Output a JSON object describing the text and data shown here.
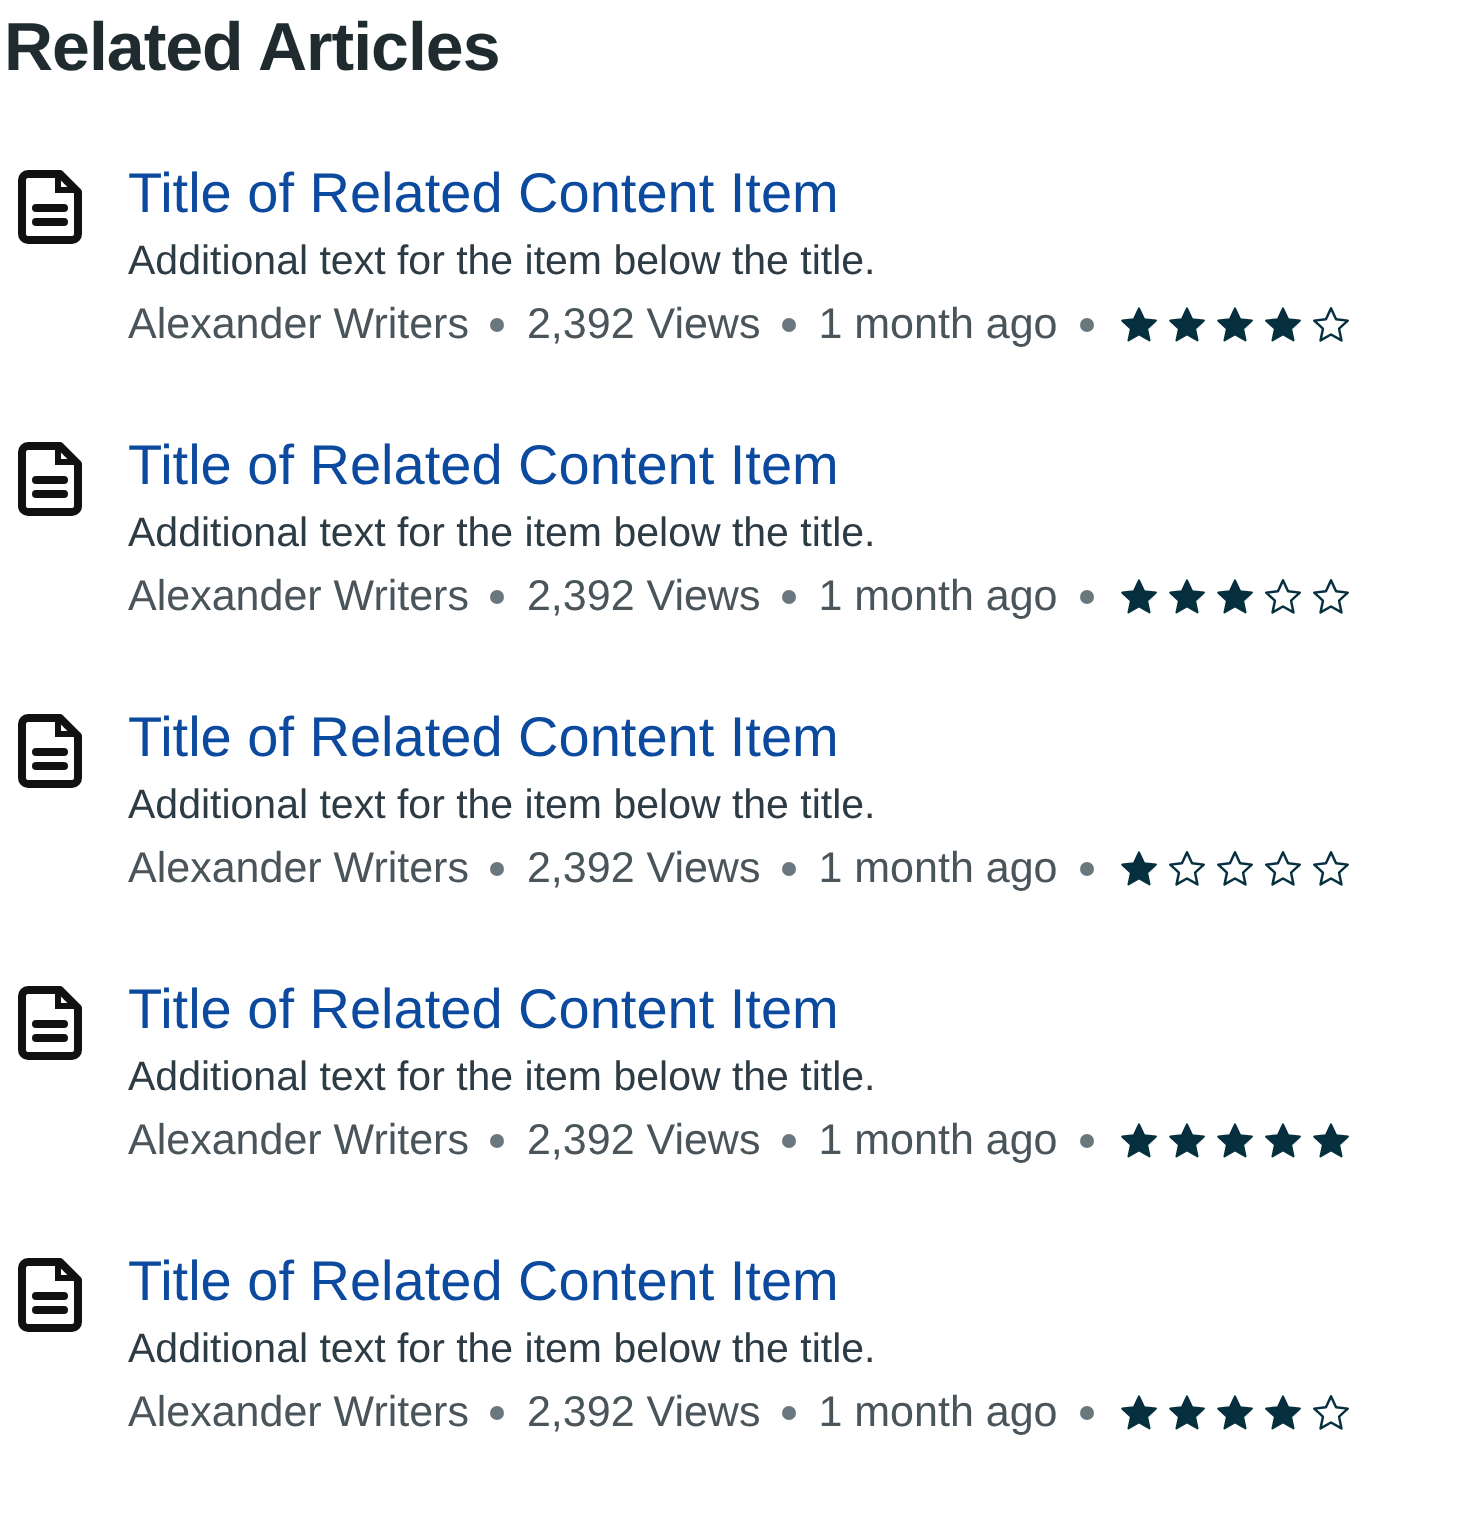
{
  "heading": "Related Articles",
  "articles": [
    {
      "title": "Title of Related Content Item",
      "description": "Additional text for the item below the title.",
      "author": "Alexander Writers",
      "views": "2,392 Views",
      "age": "1 month ago",
      "stars": 4
    },
    {
      "title": "Title of Related Content Item",
      "description": "Additional text for the item below the title.",
      "author": "Alexander Writers",
      "views": "2,392 Views",
      "age": "1 month ago",
      "stars": 3
    },
    {
      "title": "Title of Related Content Item",
      "description": "Additional text for the item below the title.",
      "author": "Alexander Writers",
      "views": "2,392 Views",
      "age": "1 month ago",
      "stars": 1
    },
    {
      "title": "Title of Related Content Item",
      "description": "Additional text for the item below the title.",
      "author": "Alexander Writers",
      "views": "2,392 Views",
      "age": "1 month ago",
      "stars": 5
    },
    {
      "title": "Title of Related Content Item",
      "description": "Additional text for the item below the title.",
      "author": "Alexander Writers",
      "views": "2,392 Views",
      "age": "1 month ago",
      "stars": 4
    }
  ]
}
